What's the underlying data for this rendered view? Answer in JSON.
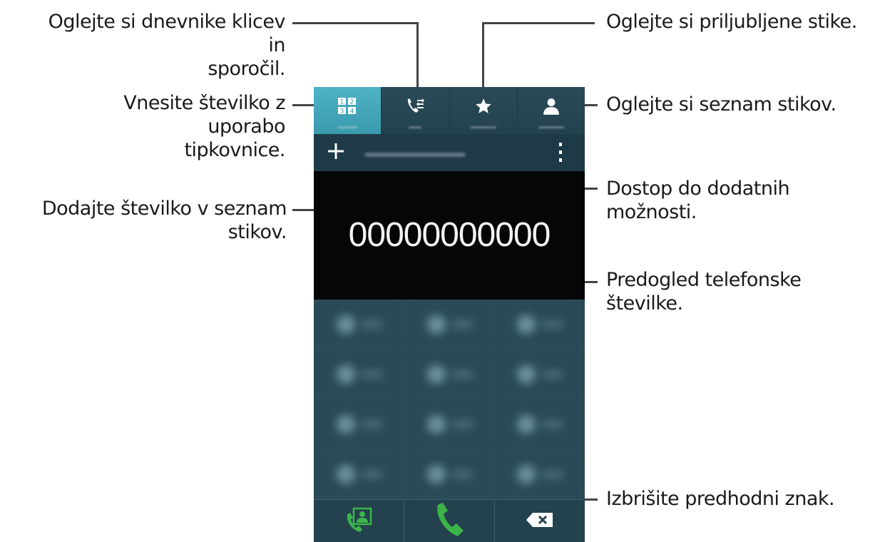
{
  "callouts": {
    "logs": "Oglejte si dnevnike klicev in sporočil.",
    "logs_line1": "Oglejte si dnevnike klicev in",
    "logs_line2": "sporočil.",
    "favorites": "Oglejte si priljubljene stike.",
    "keypad_line1": "Vnesite številko z uporabo",
    "keypad_line2": "tipkovnice.",
    "contacts": "Oglejte si seznam stikov.",
    "more_options": "Dostop do dodatnih možnosti.",
    "add_contact": "Dodajte številko v seznam stikov.",
    "preview": "Predogled telefonske številke.",
    "delete": "Izbrišite predhodni znak."
  },
  "phone": {
    "tabs": [
      {
        "icon": "dialpad-icon",
        "active": true
      },
      {
        "icon": "call-log-icon",
        "active": false
      },
      {
        "icon": "star-icon",
        "active": false
      },
      {
        "icon": "contact-person-icon",
        "active": false
      }
    ],
    "actionbar": {
      "add_icon": "plus-icon",
      "more_icon": "more-vertical-icon"
    },
    "number_display": "00000000000",
    "bottom_buttons": [
      "contacts-call-icon",
      "phone-call-icon",
      "backspace-icon"
    ]
  },
  "colors": {
    "active_tab": "#4fb3c6",
    "call_button": "#3bb54a",
    "keypad_bg": "#2a4a57"
  }
}
